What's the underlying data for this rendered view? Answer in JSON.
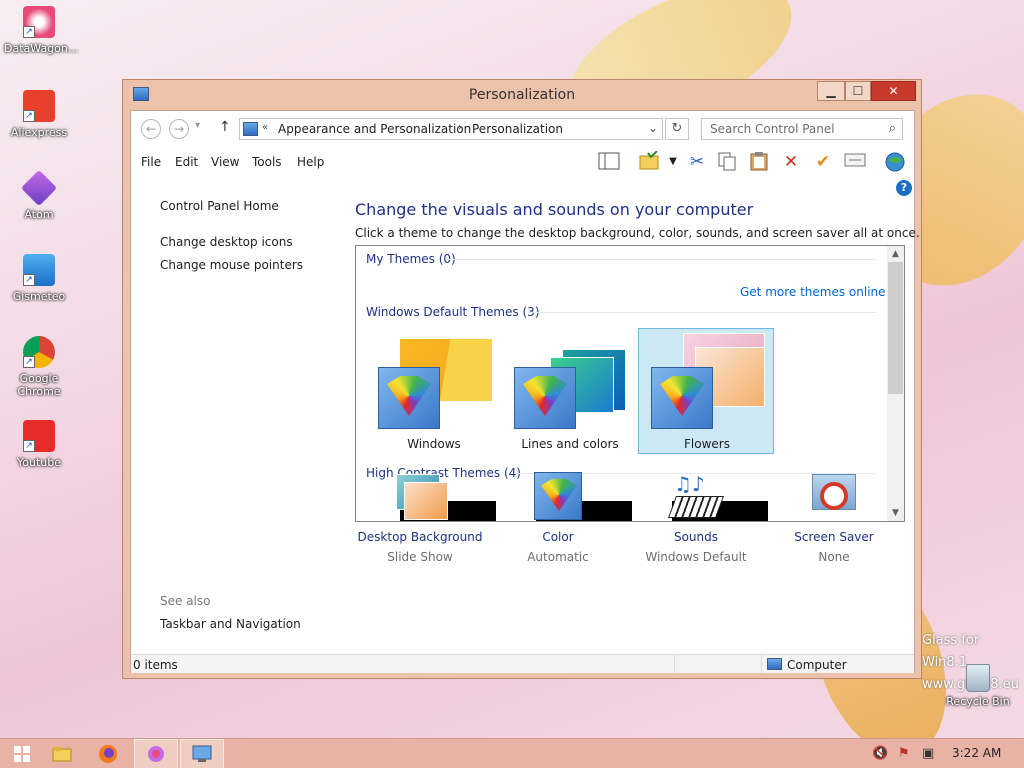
{
  "desktop": {
    "icons": [
      {
        "label": "DataWagon...",
        "color": "#e84a7a"
      },
      {
        "label": "Aliexpress",
        "color": "#e8402a"
      },
      {
        "label": "Atom",
        "color": "#9a4fd1"
      },
      {
        "label": "Gismeteo",
        "color": "#2a8ee8"
      },
      {
        "label": "Google Chrome",
        "color": "#2e9e47"
      },
      {
        "label": "Youtube",
        "color": "#e82a2a"
      }
    ],
    "recycle_bin": "Recycle Bin",
    "watermark_line1": "Glass for Win8.1",
    "watermark_line2": "www.glass8.eu"
  },
  "window": {
    "title": "Personalization",
    "controls": {
      "minimize": "▁",
      "maximize": "☐",
      "close": "✕"
    }
  },
  "navbar": {
    "back": "←",
    "forward": "→",
    "up": "↑",
    "recent": "▾",
    "address_prefix": "«",
    "crumb1": "Appearance and Personalization",
    "crumb2": "Personalization",
    "crumb_sep": "›",
    "dropdown": "⌄",
    "refresh": "↻",
    "search_placeholder": "Search Control Panel",
    "search_icon": "⌕"
  },
  "menu": [
    "File",
    "Edit",
    "View",
    "Tools",
    "Help"
  ],
  "toolbar_icons": [
    "layout-icon",
    "folder-options-icon",
    "dropdown-icon",
    "cut-icon",
    "copy-icon",
    "paste-icon",
    "delete-icon",
    "check-icon",
    "properties-icon",
    "globe-icon"
  ],
  "left_pane": {
    "home": "Control Panel Home",
    "links": [
      "Change desktop icons",
      "Change mouse pointers"
    ],
    "see_also": "See also",
    "see_also_links": [
      "Taskbar and Navigation"
    ]
  },
  "main": {
    "heading": "Change the visuals and sounds on your computer",
    "subtitle": "Click a theme to change the desktop background, color, sounds, and screen saver all at once.",
    "my_themes": "My Themes (0)",
    "get_more": "Get more themes online",
    "default_themes": "Windows Default Themes (3)",
    "themes": [
      {
        "name": "Windows",
        "selected": false
      },
      {
        "name": "Lines and colors",
        "selected": false
      },
      {
        "name": "Flowers",
        "selected": true
      }
    ],
    "high_contrast": "High Contrast Themes (4)"
  },
  "bottom_items": [
    {
      "label": "Desktop Background",
      "sub": "Slide Show"
    },
    {
      "label": "Color",
      "sub": "Automatic"
    },
    {
      "label": "Sounds",
      "sub": "Windows Default"
    },
    {
      "label": "Screen Saver",
      "sub": "None"
    }
  ],
  "statusbar": {
    "items": "0 items",
    "location": "Computer"
  },
  "taskbar": {
    "clock": "3:22 AM"
  },
  "colors": {
    "accent": "#1e3287",
    "link": "#0066cc",
    "selection": "#cde8f5",
    "close": "#c7392b",
    "taskbar": "#e8b3a4"
  }
}
